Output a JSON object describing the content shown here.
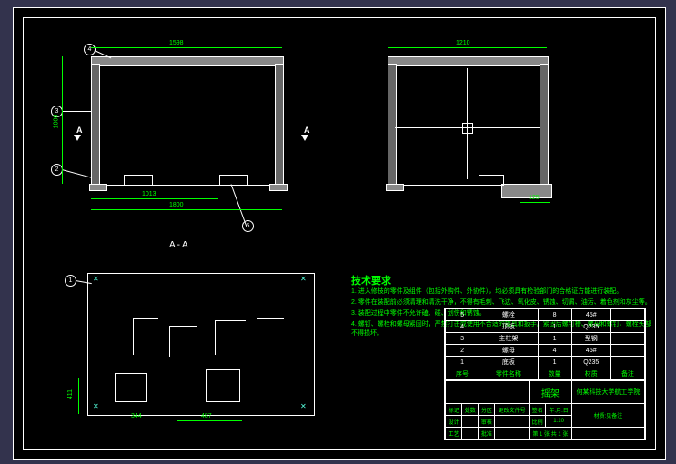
{
  "section_label": "A-A",
  "view_marker_left": "A",
  "view_marker_right": "A",
  "tech_req_title": "技术要求",
  "tech_req": [
    "1. 进入修枝的零件及组件（包括外购件、外协件），均必须具有检验部门的合格证方能进行装配。",
    "2. 零件在装配前必须清理和清洗干净，不得有毛刺、飞边、氧化皮、锈蚀、切屑、油污、着色剂和灰尘等。",
    "3. 装配过程中零件不允许磕、碰、划伤和锈蚀。",
    "4. 螺钉、螺栓和螺母紧固时，严禁打击或使用不合适的旋具和扳手。紧固后螺钉槽、螺母和螺钉、螺栓头部不得损坏。"
  ],
  "callouts": {
    "1": "1",
    "2": "2",
    "3": "3",
    "4": "4",
    "5": "5"
  },
  "dims": {
    "top_width_left": "1598",
    "top_width_right": "1210",
    "left_height": "1000",
    "bottom_seg1": "1013",
    "bottom_full": "1800",
    "right_small": "125",
    "plan_dim1": "411",
    "plan_dim2": "487",
    "plan_dim3": "344"
  },
  "corner_arrow": "→",
  "parts_list": {
    "headers": {
      "no": "序号",
      "name": "零件名称",
      "qty": "数量",
      "mat": "材质",
      "note": "备注"
    },
    "rows": [
      {
        "no": "5",
        "name": "螺栓",
        "qty": "8",
        "mat": "45#",
        "note": ""
      },
      {
        "no": "4",
        "name": "顶板",
        "qty": "1",
        "mat": "Q235",
        "note": ""
      },
      {
        "no": "3",
        "name": "主柱架",
        "qty": "1",
        "mat": "型钢",
        "note": ""
      },
      {
        "no": "2",
        "name": "螺母",
        "qty": "4",
        "mat": "45#",
        "note": ""
      },
      {
        "no": "1",
        "name": "底板",
        "qty": "1",
        "mat": "Q235",
        "note": ""
      }
    ]
  },
  "title_block": {
    "project": "摇架",
    "school": "何某科技大学航工学院",
    "material_label": "材质:见备注",
    "scale_label": "比例",
    "scale": "1:10",
    "sheet_label": "第",
    "sheet_of": "张",
    "sheet": "1",
    "total": "1",
    "stage_hdrs": [
      "标记",
      "处数",
      "分区",
      "更改文件号",
      "签名",
      "年.月.日"
    ],
    "role_hdrs": [
      "设计",
      "审核",
      "工艺",
      "批准"
    ]
  }
}
